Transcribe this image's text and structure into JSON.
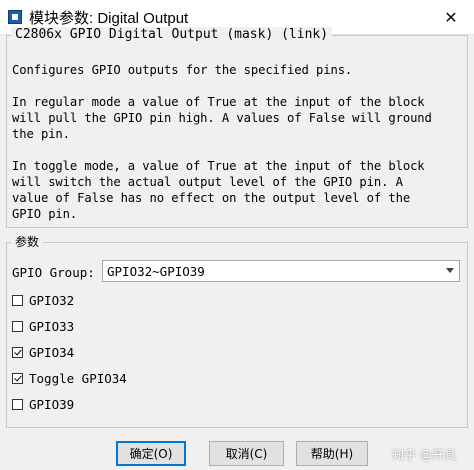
{
  "window": {
    "title": "模块参数: Digital Output",
    "close_glyph": "✕"
  },
  "description": {
    "group_title": "C2806x GPIO Digital Output (mask) (link)",
    "text": "Configures GPIO outputs for the specified pins.\n\nIn regular mode a value of True at the input of the block\nwill pull the GPIO pin high. A values of False will ground\nthe pin.\n\nIn toggle mode, a value of True at the input of the block\nwill switch the actual output level of the GPIO pin. A\nvalue of False has no effect on the output level of the\nGPIO pin."
  },
  "parameters": {
    "group_title": "参数",
    "gpio_group_label": "GPIO Group:",
    "gpio_group_value": "GPIO32~GPIO39",
    "checkboxes": [
      {
        "label": "GPIO32",
        "checked": false
      },
      {
        "label": "GPIO33",
        "checked": false
      },
      {
        "label": "GPIO34",
        "checked": true
      },
      {
        "label": "Toggle GPIO34",
        "checked": true
      },
      {
        "label": "GPIO39",
        "checked": false
      }
    ]
  },
  "buttons": {
    "ok": "确定(O)",
    "cancel": "取消(C)",
    "help": "帮助(H)"
  },
  "watermark": "知乎 @开具"
}
